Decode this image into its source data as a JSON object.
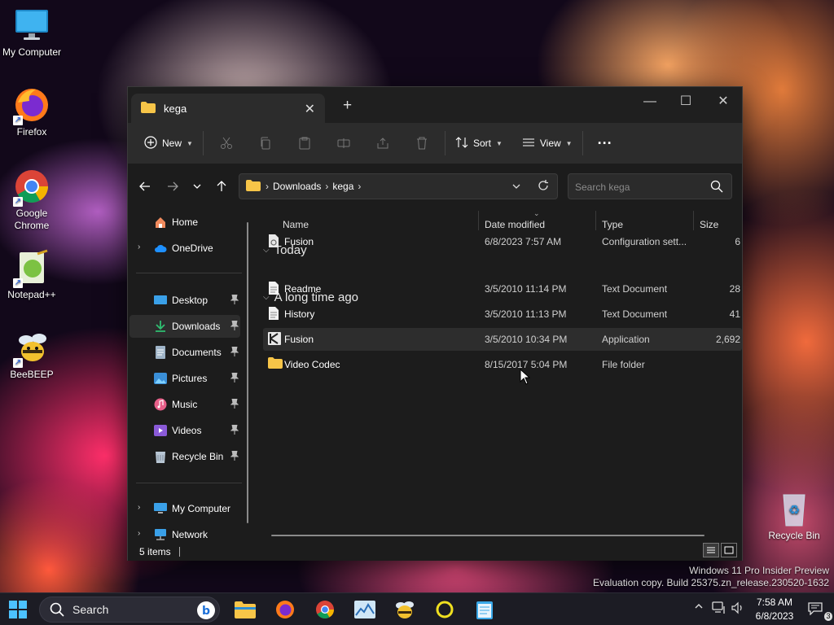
{
  "desktop": {
    "icons": [
      {
        "label": "My Computer"
      },
      {
        "label": "Firefox"
      },
      {
        "label": "Google Chrome"
      },
      {
        "label": "Notepad++"
      },
      {
        "label": "BeeBEEP"
      },
      {
        "label": "Recycle Bin"
      }
    ],
    "watermark": {
      "line1": "Windows 11 Pro Insider Preview",
      "line2": "Evaluation copy. Build 25375.zn_release.230520-1632"
    }
  },
  "explorer": {
    "tab_title": "kega",
    "toolbar": {
      "new_label": "New",
      "sort_label": "Sort",
      "view_label": "View",
      "more_label": "···"
    },
    "breadcrumb": [
      "Downloads",
      "kega"
    ],
    "search_placeholder": "Search kega",
    "sidebar": {
      "home": "Home",
      "onedrive": "OneDrive",
      "pinned": [
        "Desktop",
        "Downloads",
        "Documents",
        "Pictures",
        "Music",
        "Videos",
        "Recycle Bin"
      ],
      "my_computer": "My Computer",
      "network": "Network"
    },
    "columns": {
      "name": "Name",
      "date": "Date modified",
      "type": "Type",
      "size": "Size"
    },
    "groups": [
      {
        "title": "Today",
        "files": [
          {
            "name": "Fusion",
            "date": "6/8/2023 7:57 AM",
            "type": "Configuration sett...",
            "size": "6",
            "icon": "config-file-icon"
          }
        ]
      },
      {
        "title": "A long time ago",
        "files": [
          {
            "name": "Readme",
            "date": "3/5/2010 11:14 PM",
            "type": "Text Document",
            "size": "28",
            "icon": "text-file-icon"
          },
          {
            "name": "History",
            "date": "3/5/2010 11:13 PM",
            "type": "Text Document",
            "size": "41",
            "icon": "text-file-icon"
          },
          {
            "name": "Fusion",
            "date": "3/5/2010 10:34 PM",
            "type": "Application",
            "size": "2,692",
            "icon": "application-icon"
          },
          {
            "name": "Video Codec",
            "date": "8/15/2017 5:04 PM",
            "type": "File folder",
            "size": "",
            "icon": "folder-icon"
          }
        ]
      }
    ],
    "status": "5 items"
  },
  "taskbar": {
    "search_label": "Search",
    "clock_time": "7:58 AM",
    "clock_date": "6/8/2023",
    "notification_count": "3"
  },
  "colors": {
    "accent": "#60cdff",
    "folder": "#f7c548",
    "window_bg": "#1c1c1c",
    "toolbar_bg": "#2c2c2c"
  }
}
